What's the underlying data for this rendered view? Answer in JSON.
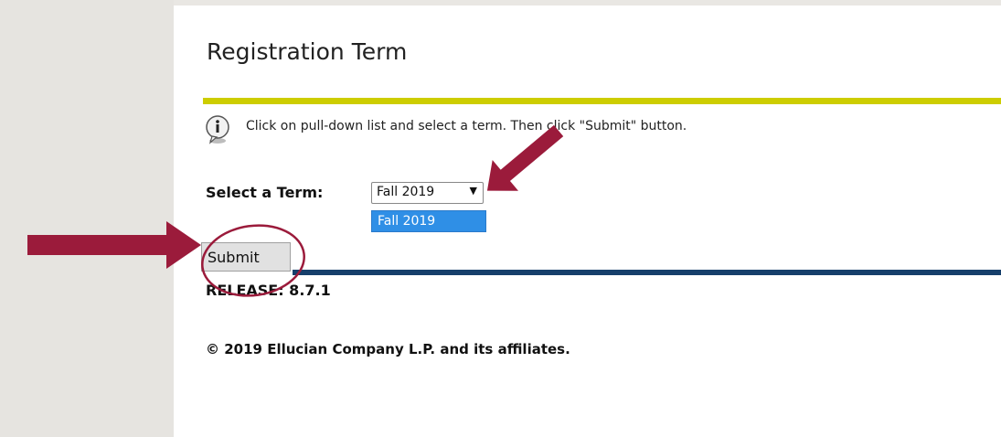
{
  "page": {
    "title": "Registration Term",
    "info_text": "Click on pull-down list and select a term. Then click \"Submit\" button.",
    "term_label": "Select a Term:",
    "term_select": {
      "selected": "Fall 2019",
      "arrow_glyph": "▼",
      "highlighted_option": "Fall 2019"
    },
    "submit_label": "Submit",
    "release": "RELEASE: 8.7.1",
    "copyright": "© 2019 Ellucian Company L.P. and its affiliates."
  },
  "colors": {
    "yellow_rule": "#cdcd00",
    "blue_rule": "#163f6b",
    "highlight": "#2f8fe6",
    "annotation": "#9b1b3b"
  },
  "icons": [
    "info-icon"
  ]
}
